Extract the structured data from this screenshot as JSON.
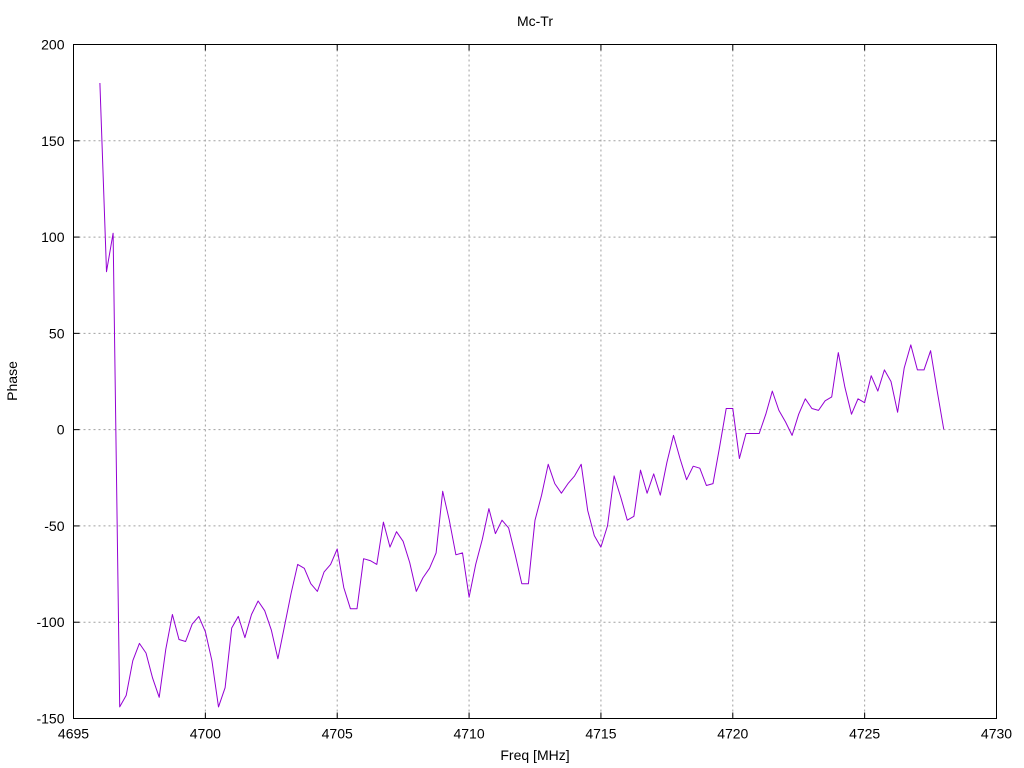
{
  "chart_data": {
    "type": "line",
    "title": "Mc-Tr",
    "xlabel": "Freq [MHz]",
    "ylabel": "Phase",
    "xlim": [
      4695,
      4730
    ],
    "ylim": [
      -150,
      200
    ],
    "grid": true,
    "legend": "none",
    "x_ticks": [
      4695,
      4700,
      4705,
      4710,
      4715,
      4720,
      4725,
      4730
    ],
    "y_ticks": [
      -150,
      -100,
      -50,
      0,
      50,
      100,
      150,
      200
    ],
    "x_tick_labels": [
      "4695",
      "4700",
      "4705",
      "4710",
      "4715",
      "4720",
      "4725",
      "4730"
    ],
    "y_tick_labels": [
      "-150",
      "-100",
      "-50",
      "0",
      "50",
      "100",
      "150",
      "200"
    ],
    "series": [
      {
        "color": "#9400d3",
        "x": [
          4696.0,
          4696.25,
          4696.5,
          4696.75,
          4697.0,
          4697.25,
          4697.5,
          4697.75,
          4698.0,
          4698.25,
          4698.5,
          4698.75,
          4699.0,
          4699.25,
          4699.5,
          4699.75,
          4700.0,
          4700.25,
          4700.5,
          4700.75,
          4701.0,
          4701.25,
          4701.5,
          4701.75,
          4702.0,
          4702.25,
          4702.5,
          4702.75,
          4703.0,
          4703.25,
          4703.5,
          4703.75,
          4704.0,
          4704.25,
          4704.5,
          4704.75,
          4705.0,
          4705.25,
          4705.5,
          4705.75,
          4706.0,
          4706.25,
          4706.5,
          4706.75,
          4707.0,
          4707.25,
          4707.5,
          4707.75,
          4708.0,
          4708.25,
          4708.5,
          4708.75,
          4709.0,
          4709.25,
          4709.5,
          4709.75,
          4710.0,
          4710.25,
          4710.5,
          4710.75,
          4711.0,
          4711.25,
          4711.5,
          4711.75,
          4712.0,
          4712.25,
          4712.5,
          4712.75,
          4713.0,
          4713.25,
          4713.5,
          4713.75,
          4714.0,
          4714.25,
          4714.5,
          4714.75,
          4715.0,
          4715.25,
          4715.5,
          4715.75,
          4716.0,
          4716.25,
          4716.5,
          4716.75,
          4717.0,
          4717.25,
          4717.5,
          4717.75,
          4718.0,
          4718.25,
          4718.5,
          4718.75,
          4719.0,
          4719.25,
          4719.5,
          4719.75,
          4720.0,
          4720.25,
          4720.5,
          4720.75,
          4721.0,
          4721.25,
          4721.5,
          4721.75,
          4722.0,
          4722.25,
          4722.5,
          4722.75,
          4723.0,
          4723.25,
          4723.5,
          4723.75,
          4724.0,
          4724.25,
          4724.5,
          4724.75,
          4725.0,
          4725.25,
          4725.5,
          4725.75,
          4726.0,
          4726.25,
          4726.5,
          4726.75,
          4727.0,
          4727.25,
          4727.5,
          4727.75,
          4728.0
        ],
        "y": [
          180,
          82,
          102,
          -144,
          -138,
          -120,
          -111,
          -116,
          -129,
          -139,
          -114,
          -96,
          -109,
          -110,
          -101,
          -97,
          -105,
          -120,
          -144,
          -134,
          -103,
          -97,
          -108,
          -96,
          -89,
          -94,
          -104,
          -119,
          -102,
          -85,
          -70,
          -72,
          -80,
          -84,
          -74,
          -70,
          -62,
          -82,
          -93,
          -93,
          -67,
          -68,
          -70,
          -48,
          -61,
          -53,
          -58,
          -69,
          -84,
          -77,
          -72,
          -64,
          -32,
          -47,
          -65,
          -64,
          -87,
          -70,
          -57,
          -41,
          -54,
          -47,
          -51,
          -65,
          -80,
          -80,
          -47,
          -34,
          -18,
          -28,
          -33,
          -28,
          -24,
          -18,
          -42,
          -55,
          -61,
          -50,
          -24,
          -35,
          -47,
          -45,
          -21,
          -33,
          -23,
          -34,
          -17,
          -3,
          -15,
          -26,
          -19,
          -20,
          -29,
          -28,
          -9,
          11,
          11,
          -15,
          -2,
          -2,
          -2,
          8,
          20,
          10,
          4,
          -3,
          8,
          16,
          11,
          10,
          15,
          17,
          40,
          22,
          8,
          16,
          14,
          28,
          20,
          31,
          25,
          9,
          32,
          44,
          31,
          31,
          41,
          20,
          0
        ]
      }
    ]
  }
}
